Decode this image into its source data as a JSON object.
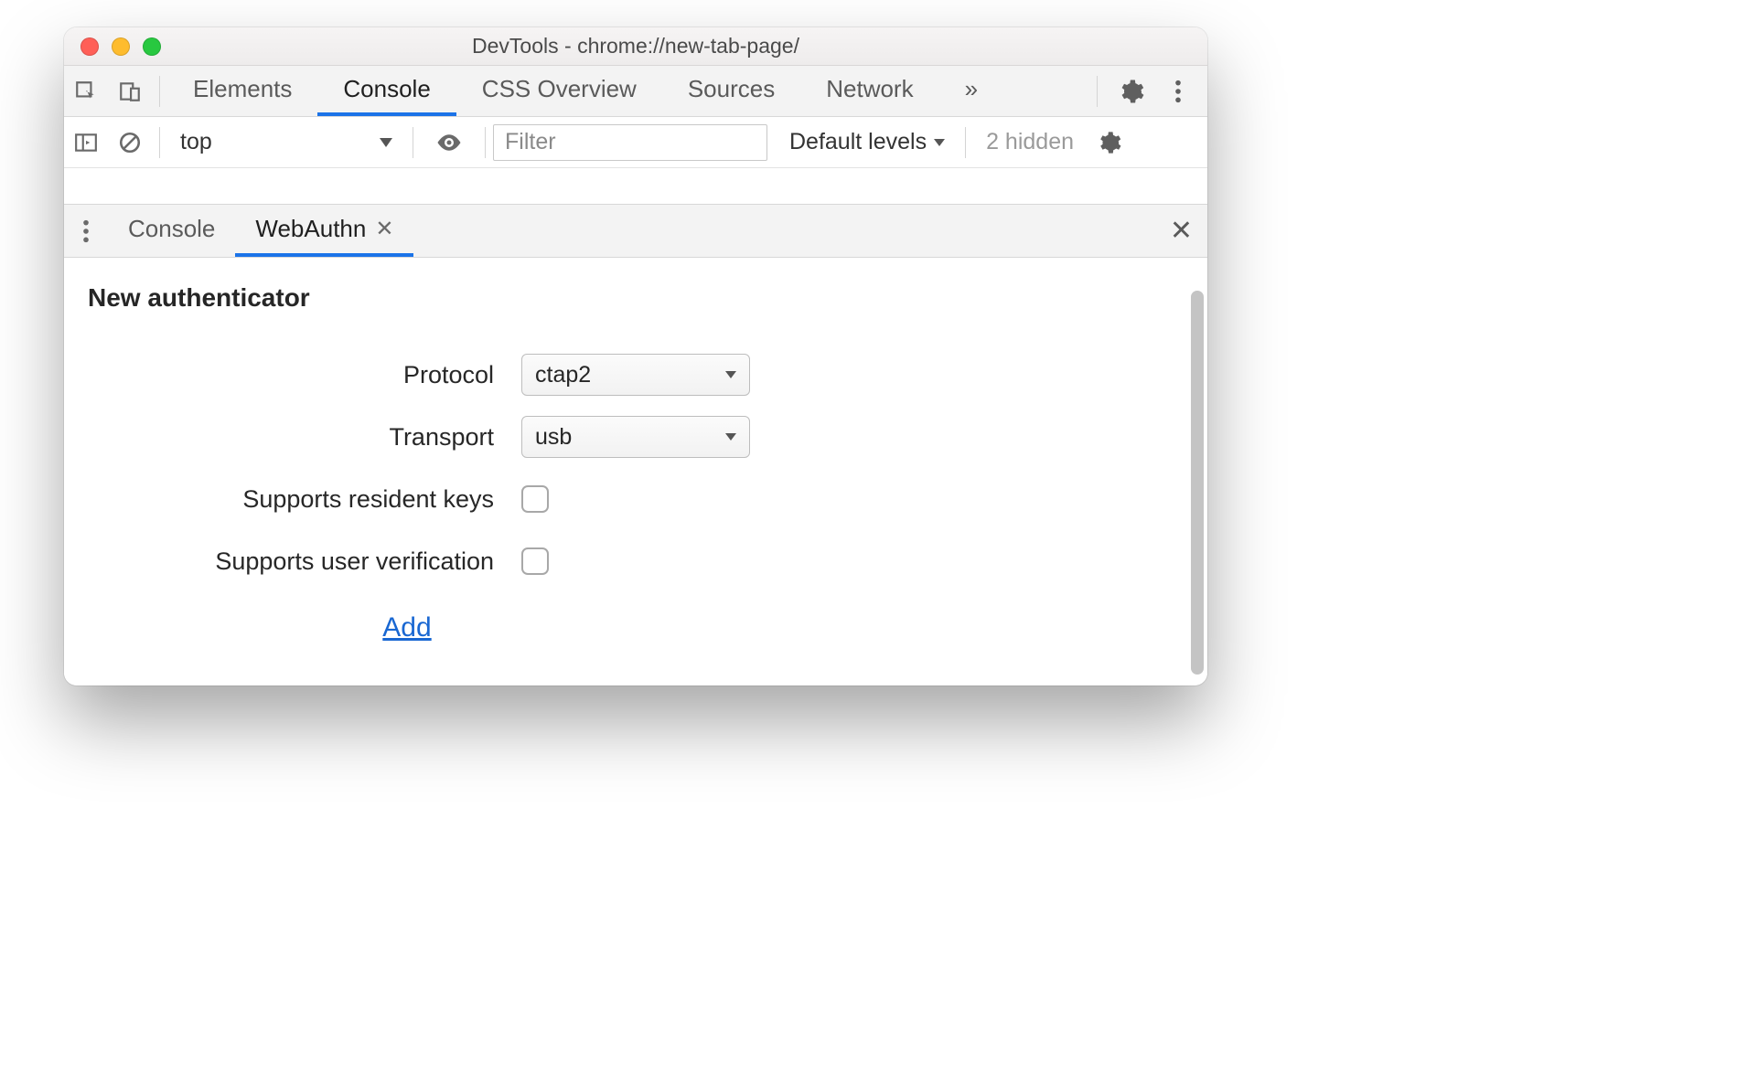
{
  "window": {
    "title": "DevTools - chrome://new-tab-page/"
  },
  "main_tabs": {
    "items": [
      "Elements",
      "Console",
      "CSS Overview",
      "Sources",
      "Network"
    ],
    "overflow": "»",
    "active_index": 1
  },
  "console_toolbar": {
    "context": "top",
    "filter_placeholder": "Filter",
    "levels": "Default levels",
    "hidden": "2 hidden"
  },
  "drawer": {
    "tabs": [
      "Console",
      "WebAuthn"
    ],
    "active_index": 1
  },
  "webauthn": {
    "section_title": "New authenticator",
    "labels": {
      "protocol": "Protocol",
      "transport": "Transport",
      "resident": "Supports resident keys",
      "userverify": "Supports user verification"
    },
    "values": {
      "protocol": "ctap2",
      "transport": "usb",
      "resident_checked": false,
      "userverify_checked": false
    },
    "add": "Add"
  }
}
